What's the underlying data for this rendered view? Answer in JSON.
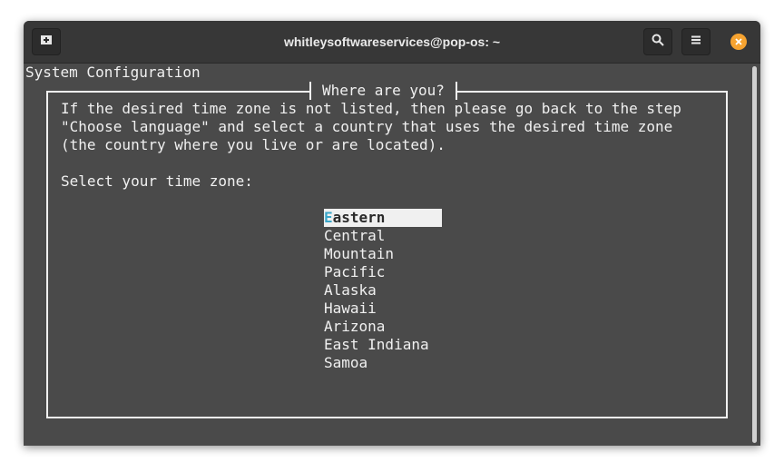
{
  "window": {
    "title": "whitleysoftwareservices@pop-os: ~"
  },
  "titlebar": {
    "new_tab_icon": "new-tab-icon",
    "search_icon": "search-icon",
    "menu_icon": "hamburger-menu-icon",
    "close_icon": "close-icon",
    "close_color": "#f6a330"
  },
  "terminal": {
    "header": "System Configuration",
    "dialog": {
      "title": "Where are you?",
      "text_lines": [
        "If the desired time zone is not listed, then please go back to the step",
        "\"Choose language\" and select a country that uses the desired time zone",
        "(the country where you live or are located)."
      ],
      "prompt": "Select your time zone:",
      "options": [
        {
          "hotkey": "E",
          "rest": "astern",
          "label": "Eastern",
          "selected": true
        },
        {
          "label": "Central"
        },
        {
          "label": "Mountain"
        },
        {
          "label": "Pacific"
        },
        {
          "label": "Alaska"
        },
        {
          "label": "Hawaii"
        },
        {
          "label": "Arizona"
        },
        {
          "label": "East Indiana"
        },
        {
          "label": "Samoa"
        }
      ],
      "hotkey_color": "#3aa6c9"
    }
  }
}
